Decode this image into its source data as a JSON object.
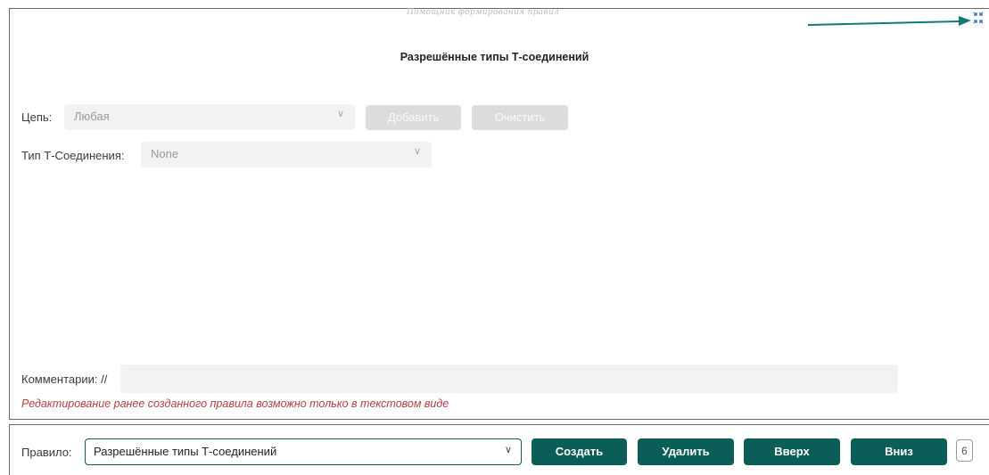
{
  "watermark": "Помощник формирования правил",
  "title": "Разрешённые типы Т-соединений",
  "chain": {
    "label": "Цепь:",
    "value": "Любая",
    "add_label": "Добавить",
    "clear_label": "Очистить"
  },
  "joint_type": {
    "label": "Тип Т-Соединения:",
    "value": "None"
  },
  "comment": {
    "label": "Комментарии: //",
    "value": ""
  },
  "note": "Редактирование ранее созданного правила возможно только в текстовом виде",
  "rule": {
    "label": "Правило:",
    "value": "Разрешённые типы Т-соединений"
  },
  "buttons": {
    "create": "Создать",
    "delete": "Удалить",
    "up": "Вверх",
    "down": "Вниз"
  },
  "counter": "6",
  "icons": {
    "dropdown": "chevron-down-icon",
    "collapse": "collapse-icon"
  },
  "colors": {
    "accent": "#0b5d57",
    "arrow": "#117a79",
    "note": "#b0403f"
  }
}
